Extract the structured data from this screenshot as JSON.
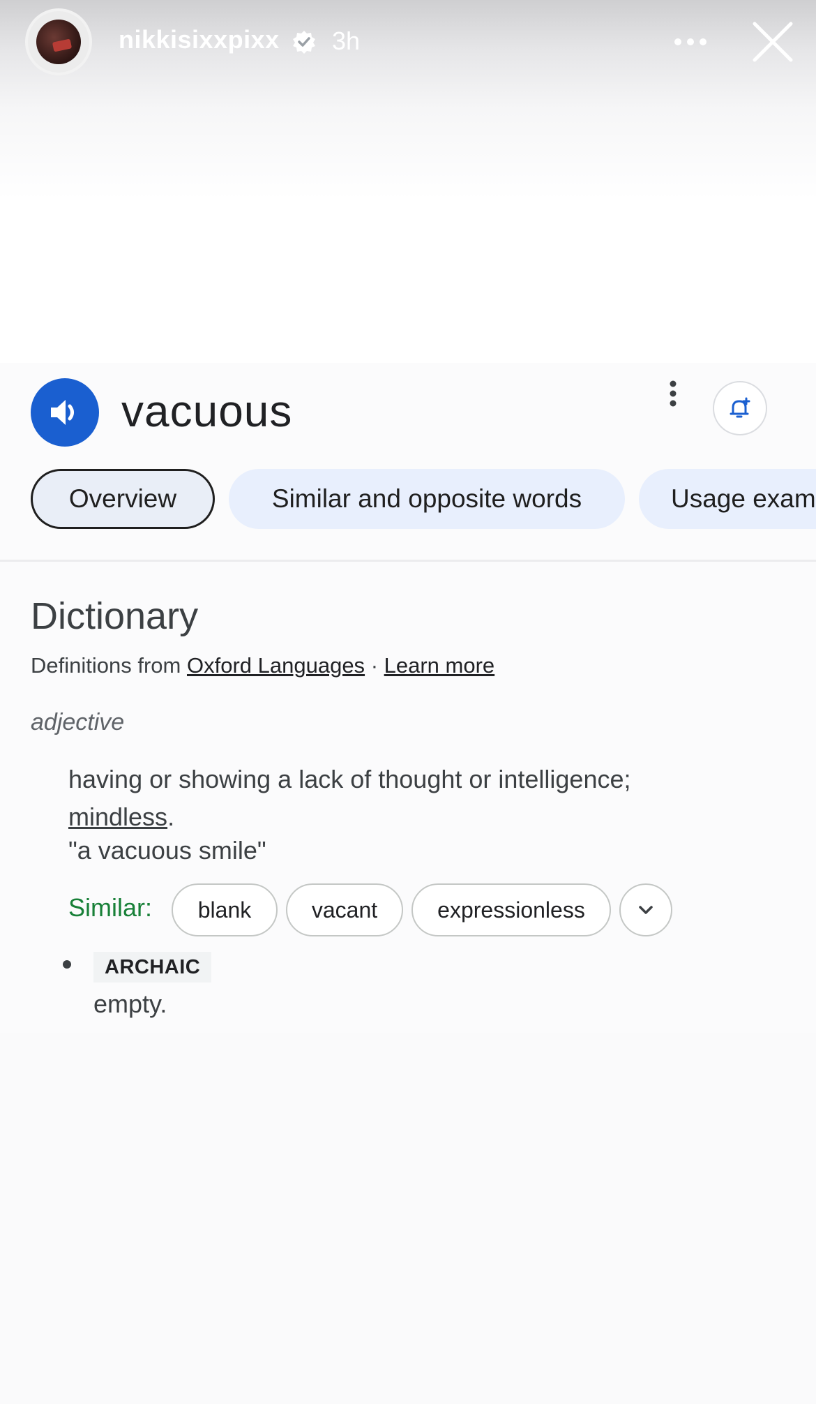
{
  "story": {
    "username": "nikkisixxpixx",
    "time": "3h"
  },
  "entry": {
    "word": "vacuous"
  },
  "tabs": [
    {
      "label": "Overview"
    },
    {
      "label": "Similar and opposite words"
    },
    {
      "label": "Usage exam"
    }
  ],
  "dictionary": {
    "heading": "Dictionary",
    "source_prefix": "Definitions from",
    "source_link": "Oxford Languages",
    "separator": "·",
    "learn_more": "Learn more",
    "part_of_speech": "adjective",
    "definition_text": "having or showing a lack of thought or intelligence;",
    "definition_link": "mindless",
    "definition_end": ".",
    "example": "\"a vacuous smile\"",
    "similar_label": "Similar:",
    "similar_words": [
      "blank",
      "vacant",
      "expressionless"
    ],
    "sense2_label": "ARCHAIC",
    "sense2_text": "empty."
  },
  "colors": {
    "accent_blue": "#1a5fd0",
    "similar_green": "#188038",
    "tab_bg": "#e8effd"
  }
}
